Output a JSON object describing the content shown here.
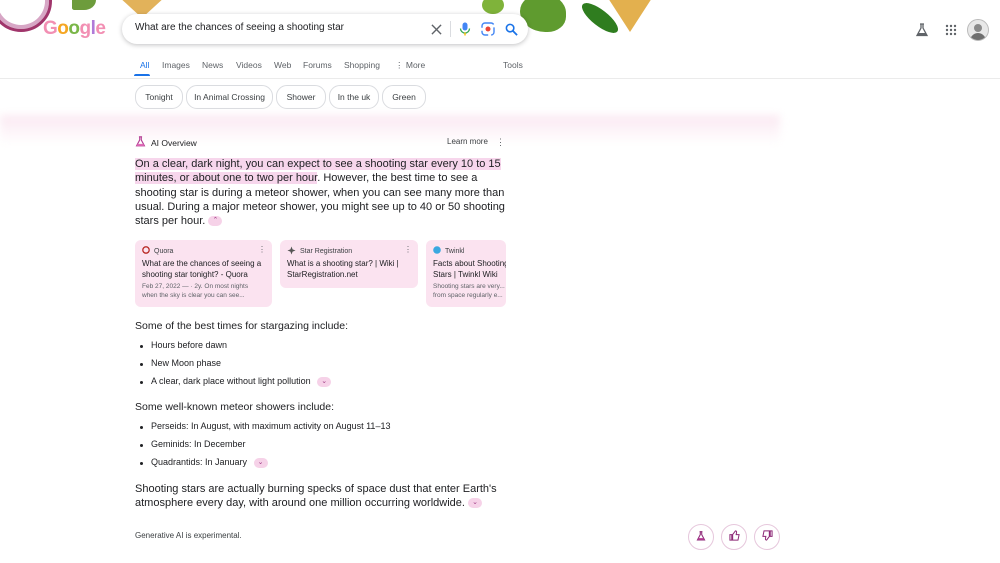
{
  "logo": {
    "letters": [
      "G",
      "o",
      "o",
      "g",
      "l",
      "e"
    ]
  },
  "search": {
    "query": "What are the chances of seeing a shooting star"
  },
  "icons": {
    "clear": "close-icon",
    "voice": "mic-icon",
    "lens": "lens-icon",
    "search": "search-icon",
    "labs": "flask-icon",
    "apps": "apps-grid-icon",
    "account": "avatar"
  },
  "tabs": [
    "All",
    "Images",
    "News",
    "Videos",
    "Web",
    "Forums",
    "Shopping",
    "More",
    "Tools"
  ],
  "chips": [
    "Tonight",
    "In Animal Crossing",
    "Shower",
    "In the uk",
    "Green"
  ],
  "ai_overview": {
    "label": "AI Overview",
    "learn_more": "Learn more",
    "highlight": "On a clear, dark night, you can expect to see a shooting star every 10 to 15 minutes, or about one to two per hour",
    "rest": ". However, the best time to see a shooting star is during a meteor shower, when you can see many more than usual. During a major meteor shower, you might see up to 40 or 50 shooting stars per hour."
  },
  "cards": [
    {
      "source": "Quora",
      "title": "What are the chances of seeing a shooting star tonight? - Quora",
      "snippet_line1": "Feb 27, 2022 — · 2y. On most nights",
      "snippet_line2": "when the sky is clear you can see..."
    },
    {
      "source": "Star Registration",
      "title": "What is a shooting star? | Wiki | StarRegistration.net",
      "snippet_line1": "",
      "snippet_line2": ""
    },
    {
      "source": "Twinkl",
      "title": "Facts about Shooting Stars | Twinkl Wiki",
      "snippet_line1": "Shooting stars are very...",
      "snippet_line2": "from space regularly e..."
    }
  ],
  "stargazing": {
    "heading": "Some of the best times for stargazing include:",
    "items": [
      "Hours before dawn",
      "New Moon phase",
      "A clear, dark place without light pollution"
    ]
  },
  "showers": {
    "heading": "Some well-known meteor showers include:",
    "items": [
      "Perseids: In August, with maximum activity on August 11–13",
      "Geminids: In December",
      "Quadrantids: In January"
    ]
  },
  "closing": "Shooting stars are actually burning specks of space dust that enter Earth's atmosphere every day, with around one million occurring worldwide.",
  "footer": {
    "experimental": "Generative AI is experimental."
  },
  "colors": {
    "accent": "#1a73e8",
    "ai_pink": "#f7d6ec",
    "card_bg": "#fbe3f0"
  }
}
